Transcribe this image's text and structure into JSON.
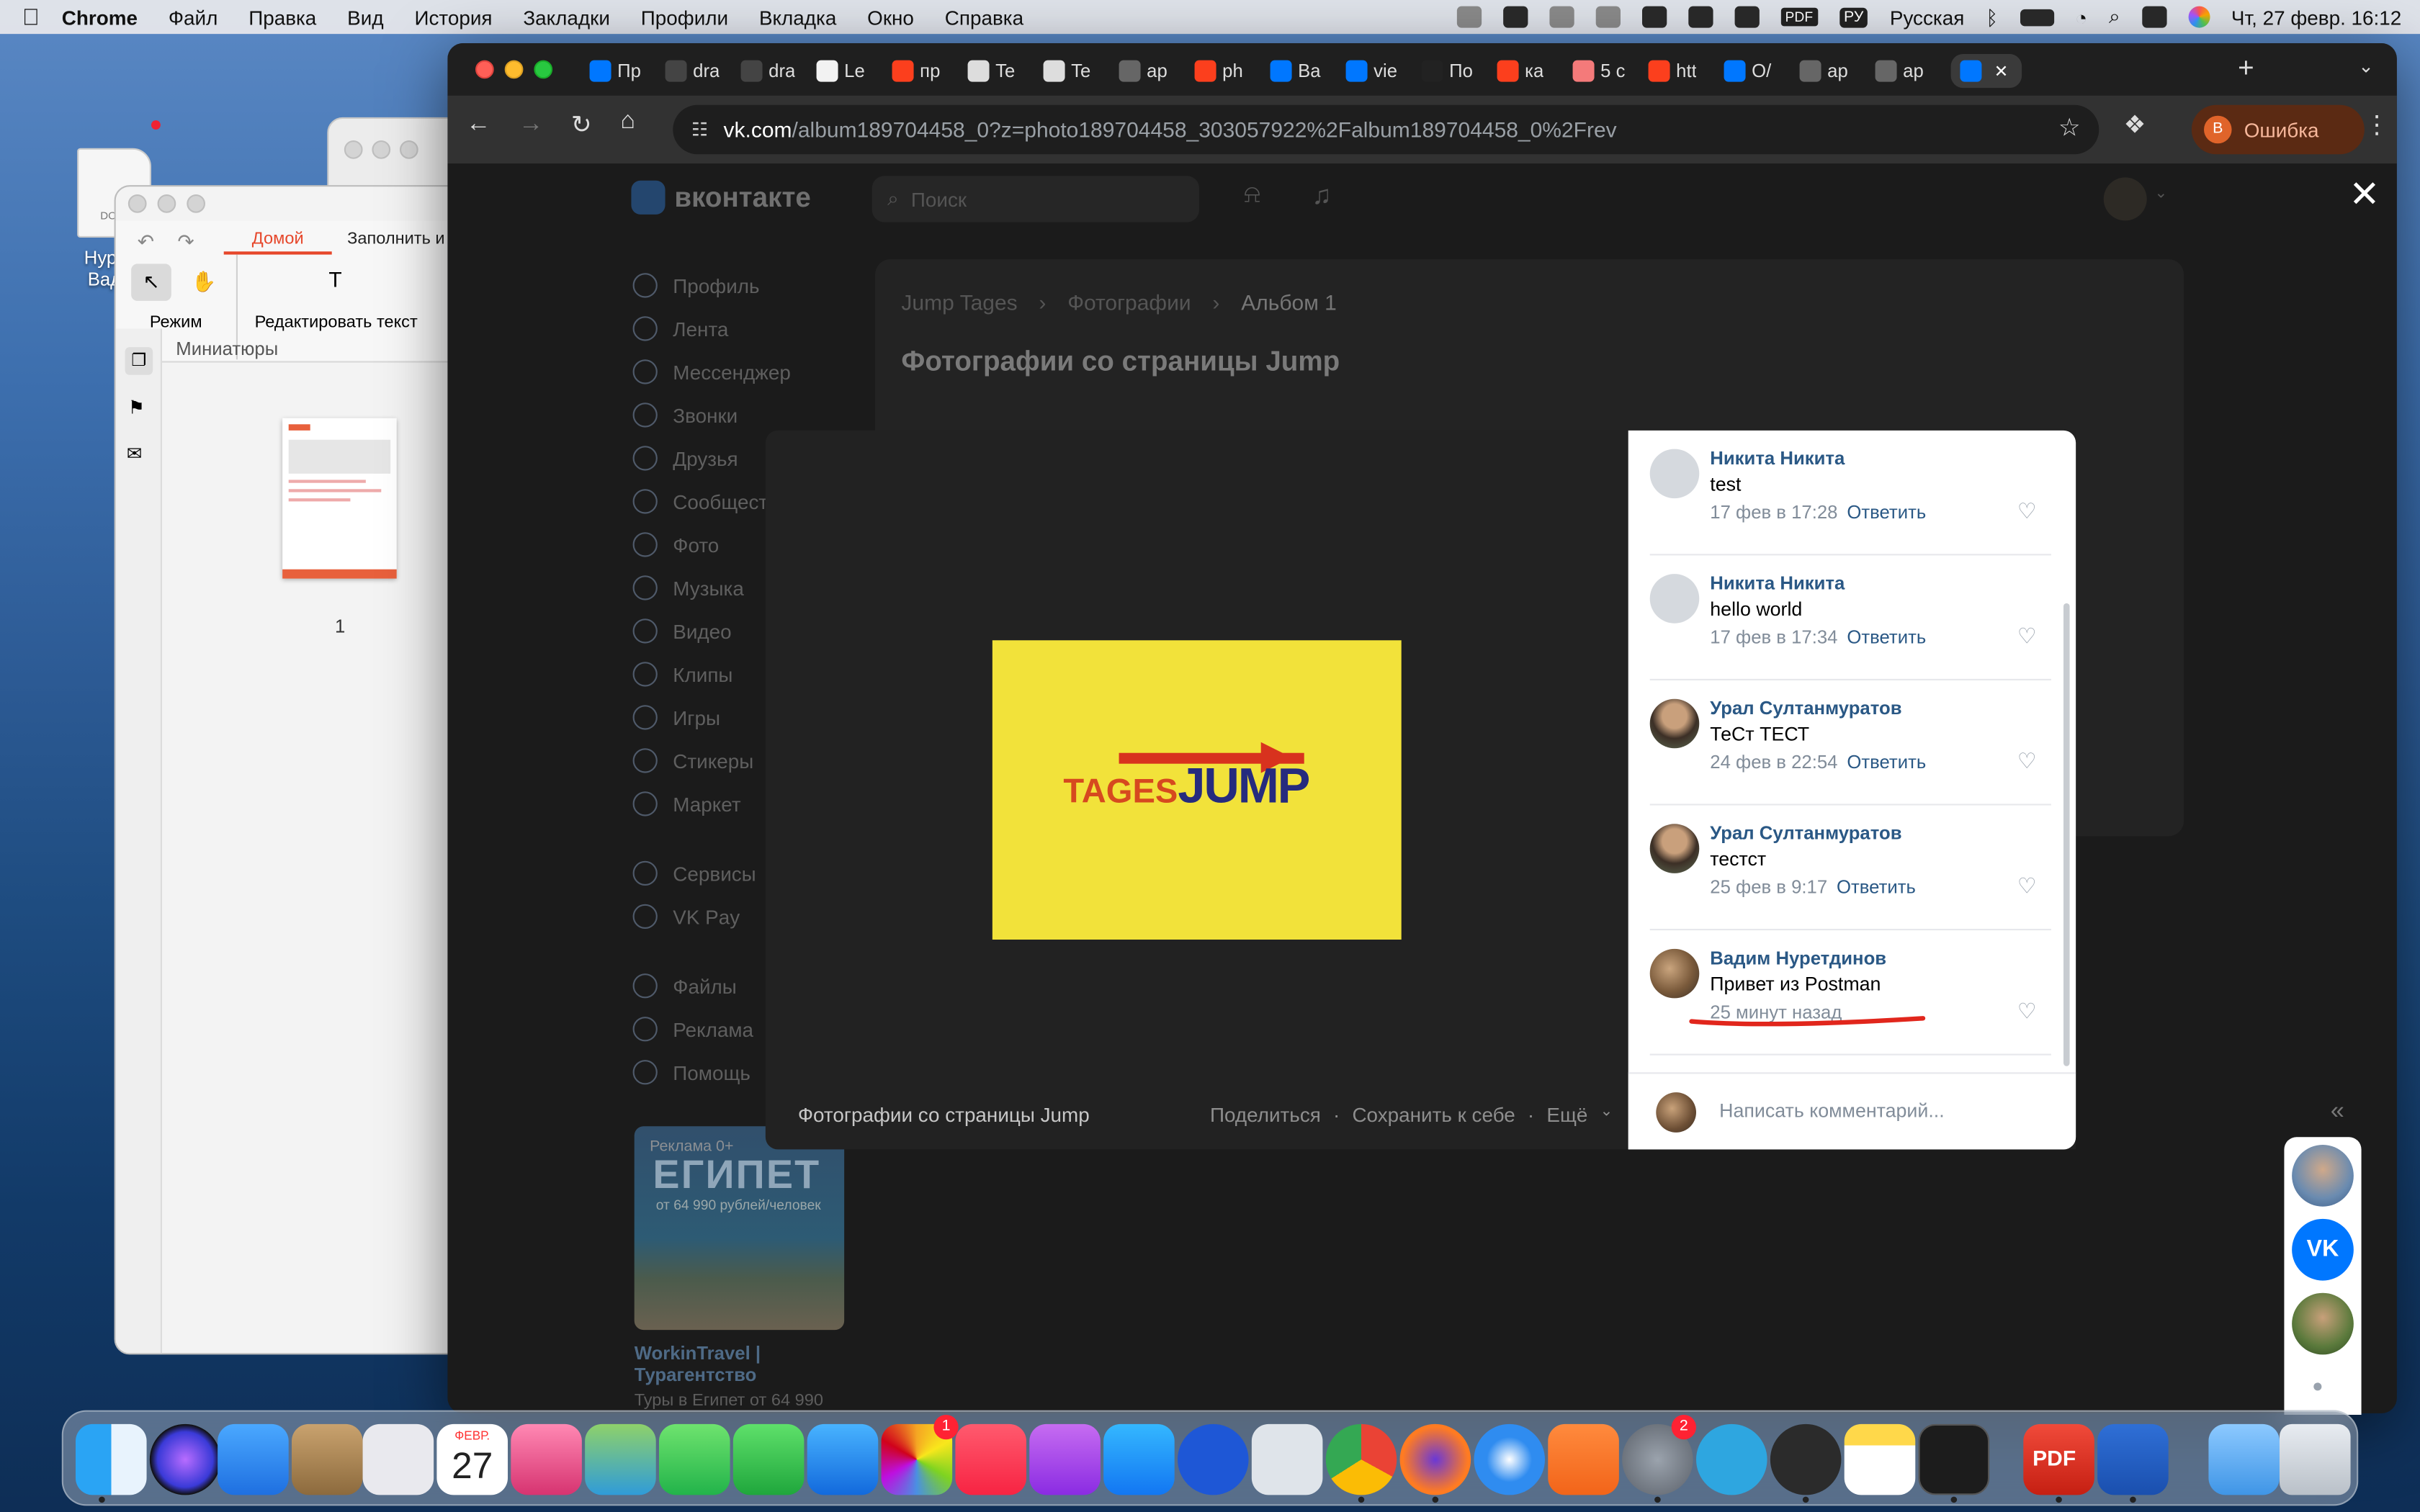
{
  "menubar": {
    "app": "Chrome",
    "items": [
      "Файл",
      "Правка",
      "Вид",
      "История",
      "Закладки",
      "Профили",
      "Вкладка",
      "Окно",
      "Справка"
    ],
    "keyboard": "Русская",
    "input_flag": "РУ",
    "pdf_icon": "PDF",
    "datetime": "Чт, 27 февр.  16:12"
  },
  "desktop": {
    "file_label_1": "Нурет",
    "file_label_2": "Вади",
    "file_sublabel": "DO"
  },
  "pdf_app": {
    "tab_home": "Домой",
    "tab_fill": "Заполнить и",
    "mode_label": "Режим",
    "edit_text_label": "Редактировать текст",
    "text_tool": "T",
    "thumbnails_title": "Миниатюры",
    "page_number": "1"
  },
  "chrome": {
    "tabs": [
      {
        "icon": "vk",
        "title": "Пр"
      },
      {
        "icon": "draw",
        "title": "dra"
      },
      {
        "icon": "draw",
        "title": "dra"
      },
      {
        "icon": "gmail",
        "title": "Le"
      },
      {
        "icon": "yandex",
        "title": "пр"
      },
      {
        "icon": "image",
        "title": "Te"
      },
      {
        "icon": "image",
        "title": "Te"
      },
      {
        "icon": "globe",
        "title": "ap"
      },
      {
        "icon": "yandex",
        "title": "ph"
      },
      {
        "icon": "vk",
        "title": "Ва"
      },
      {
        "icon": "vk",
        "title": "vie"
      },
      {
        "icon": "openai",
        "title": "По"
      },
      {
        "icon": "yandex",
        "title": "ка"
      },
      {
        "icon": "red",
        "title": "5 с"
      },
      {
        "icon": "yandex",
        "title": "htt"
      },
      {
        "icon": "vk",
        "title": "О/"
      },
      {
        "icon": "globe",
        "title": "ap"
      },
      {
        "icon": "globe",
        "title": "ap"
      },
      {
        "icon": "vk",
        "title": ""
      }
    ],
    "url_host": "vk.com",
    "url_path": "/album189704458_0?z=photo189704458_303057922%2Falbum189704458_0%2Frev",
    "profile_initial": "В",
    "profile_status": "Ошибка"
  },
  "vk": {
    "logo": "вконтакте",
    "search_placeholder": "Поиск",
    "nav": [
      {
        "label": "Профиль",
        "name": "nav-profile"
      },
      {
        "label": "Лента",
        "name": "nav-feed"
      },
      {
        "label": "Мессенджер",
        "name": "nav-messenger"
      },
      {
        "label": "Звонки",
        "name": "nav-calls"
      },
      {
        "label": "Друзья",
        "name": "nav-friends"
      },
      {
        "label": "Сообщест",
        "name": "nav-communities"
      },
      {
        "label": "Фото",
        "name": "nav-photos"
      },
      {
        "label": "Музыка",
        "name": "nav-music"
      },
      {
        "label": "Видео",
        "name": "nav-video"
      },
      {
        "label": "Клипы",
        "name": "nav-clips"
      },
      {
        "label": "Игры",
        "name": "nav-games"
      },
      {
        "label": "Стикеры",
        "name": "nav-stickers"
      },
      {
        "label": "Маркет",
        "name": "nav-market"
      }
    ],
    "nav2": [
      {
        "label": "Сервисы",
        "name": "nav-services"
      },
      {
        "label": "VK Pay",
        "name": "nav-vkpay"
      }
    ],
    "nav3": [
      {
        "label": "Файлы",
        "name": "nav-files"
      },
      {
        "label": "Реклама",
        "name": "nav-ads"
      },
      {
        "label": "Помощь",
        "name": "nav-help"
      }
    ],
    "breadcrumb": [
      "Jump Tages",
      "Фотографии",
      "Альбом 1"
    ],
    "page_title": "Фотографии со страницы Jump",
    "ad": {
      "tag": "Реклама 0+",
      "headline": "ЕГИПЕТ",
      "subline": "от 64 990 рублей/человек",
      "title": "WorkinTravel | Турагентство",
      "desc": "Туры в Египет от 64 990"
    }
  },
  "viewer": {
    "logo_left": "TAGES",
    "logo_right": "JUMP",
    "caption": "Фотографии со страницы Jump",
    "share": "Поделиться",
    "save": "Сохранить к себе",
    "more": "Ещё",
    "comment_placeholder": "Написать комментарий...",
    "reply_label": "Ответить",
    "comments": [
      {
        "author": "Никита Никита",
        "text": "test",
        "date": "17 фев в 17:28",
        "avatar": "default"
      },
      {
        "author": "Никита Никита",
        "text": "hello world",
        "date": "17 фев в 17:34",
        "avatar": "default"
      },
      {
        "author": "Урал Султанмуратов",
        "text": "ТеСт ТЕСТ",
        "date": "24 фев в 22:54",
        "avatar": "photo"
      },
      {
        "author": "Урал Султанмуратов",
        "text": "тестст",
        "date": "25 фев в 9:17",
        "avatar": "photo"
      },
      {
        "author": "Вадим Нуретдинов",
        "text": "Привет из Postman",
        "date": "25 минут назад",
        "avatar": "photo2"
      }
    ]
  },
  "dock": {
    "photos_badge": "1",
    "settings_badge": "2",
    "calendar_month": "ФЕВР.",
    "calendar_day": "27",
    "pdf_label": "PDF"
  },
  "colors": {
    "vk_blue": "#0077ff",
    "link": "#2a5885",
    "highlight_underline": "#e1261c",
    "logo_yellow": "#f2e23a"
  }
}
